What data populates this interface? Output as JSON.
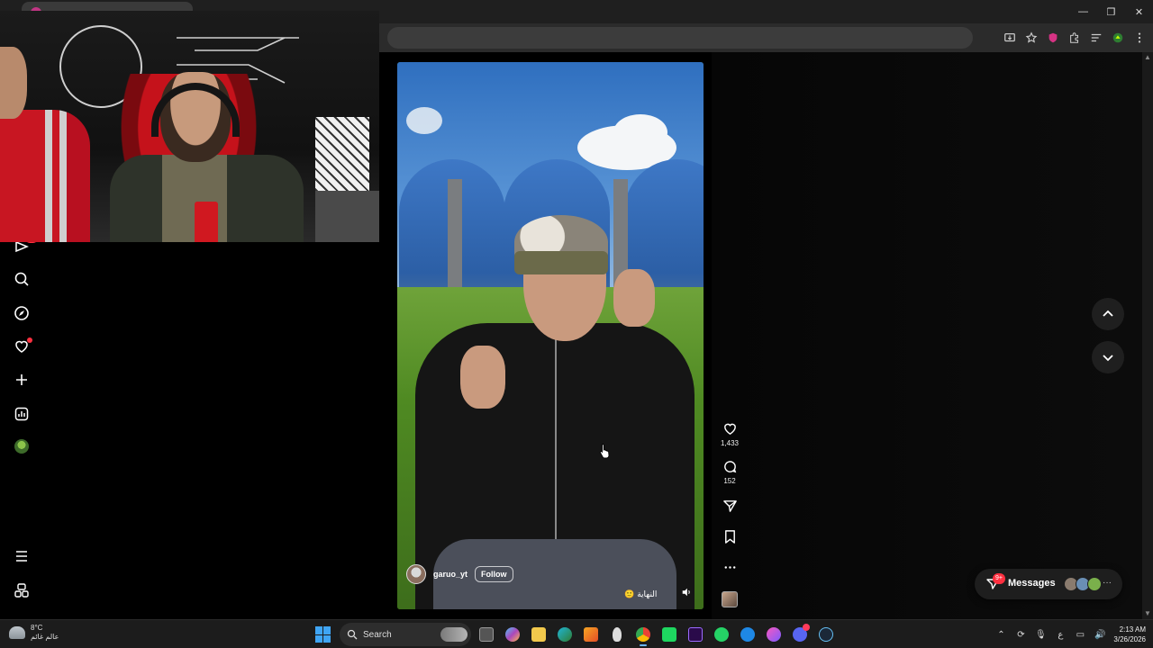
{
  "browser": {
    "window_controls": {
      "minimize": "—",
      "restore": "❐",
      "close": "✕"
    }
  },
  "sidenav": {
    "items": [
      {
        "name": "reels",
        "icon": "reels-icon"
      },
      {
        "name": "search",
        "icon": "search-icon"
      },
      {
        "name": "explore",
        "icon": "compass-icon"
      },
      {
        "name": "notifications",
        "icon": "heart-icon"
      },
      {
        "name": "create",
        "icon": "plus-icon"
      },
      {
        "name": "dashboard",
        "icon": "dashboard-icon"
      },
      {
        "name": "profile",
        "icon": "avatar"
      },
      {
        "name": "more",
        "icon": "menu-icon"
      },
      {
        "name": "also-from-meta",
        "icon": "threads-icon"
      }
    ]
  },
  "reel": {
    "owner": "garuo_yt",
    "follow_label": "Follow",
    "audio_label": "النهاية",
    "audio_emoji": "🙂"
  },
  "actions": {
    "likes": "1,433",
    "comments": "152"
  },
  "messages": {
    "label": "Messages",
    "badge": "9+"
  },
  "taskbar": {
    "weather_temp": "8°C",
    "weather_desc": "عالم غائم",
    "search_label": "Search",
    "tray_lang": "ع",
    "time": "2:13 AM",
    "date": "3/26/2026"
  },
  "colors": {
    "accent_red": "#ff3040",
    "page_bg": "#000000",
    "windows_blue": "#3fa5f5"
  }
}
